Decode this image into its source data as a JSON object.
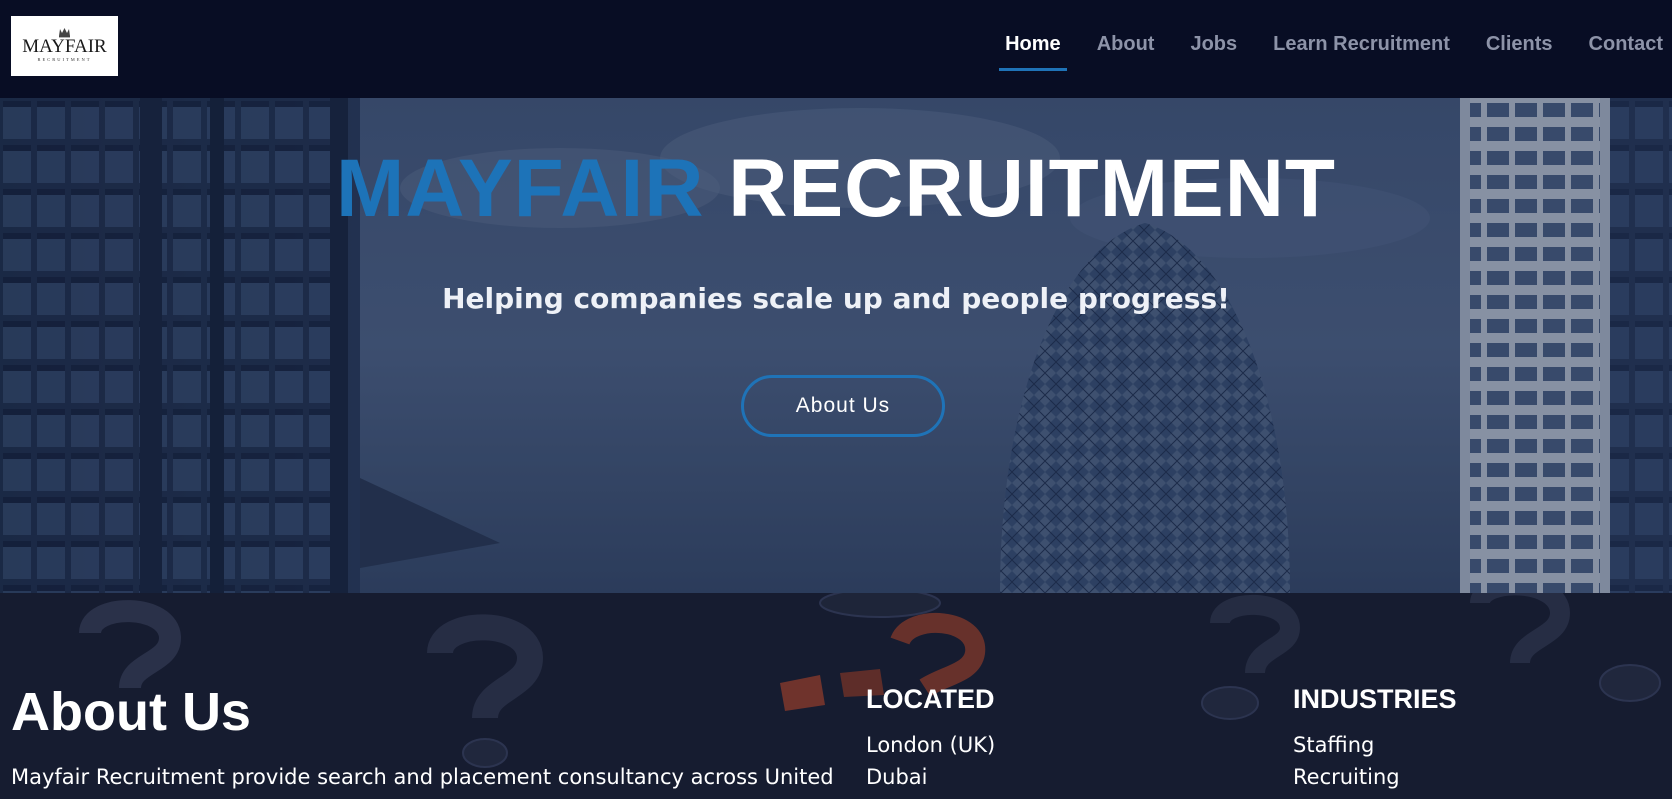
{
  "brand": {
    "logo_word": "MAYFAIR",
    "logo_sub": "RECRUITMENT"
  },
  "nav": {
    "items": [
      {
        "label": "Home",
        "active": true
      },
      {
        "label": "About",
        "active": false
      },
      {
        "label": "Jobs",
        "active": false
      },
      {
        "label": "Learn Recruitment",
        "active": false
      },
      {
        "label": "Clients",
        "active": false
      },
      {
        "label": "Contact",
        "active": false
      }
    ]
  },
  "hero": {
    "title_part1": "MAYFAIR",
    "title_part2": "RECRUITMENT",
    "tagline": "Helping companies scale up and people progress!",
    "button_label": "About Us"
  },
  "about": {
    "heading": "About Us",
    "text": "Mayfair Recruitment provide search and placement consultancy across United"
  },
  "located": {
    "heading": "LOCATED",
    "items": [
      "London (UK)",
      "Dubai"
    ]
  },
  "industries": {
    "heading": "INDUSTRIES",
    "items": [
      "Staffing",
      "Recruiting"
    ]
  },
  "colors": {
    "accent": "#1f73b7",
    "nav_bg": "#080d24",
    "section_bg": "#161c30"
  }
}
